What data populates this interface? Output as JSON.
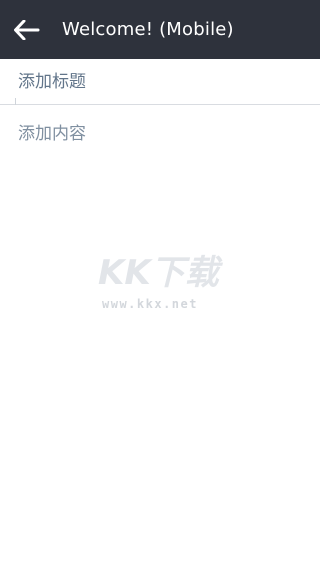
{
  "header": {
    "title": "Welcome! (Mobile)",
    "back_icon": "arrow-left-icon",
    "background_color": "#2e323c"
  },
  "editor": {
    "title_placeholder": "添加标题",
    "content_placeholder": "添加内容"
  },
  "watermark": {
    "logo_text": "KK下载",
    "url": "www.kkx.net"
  }
}
